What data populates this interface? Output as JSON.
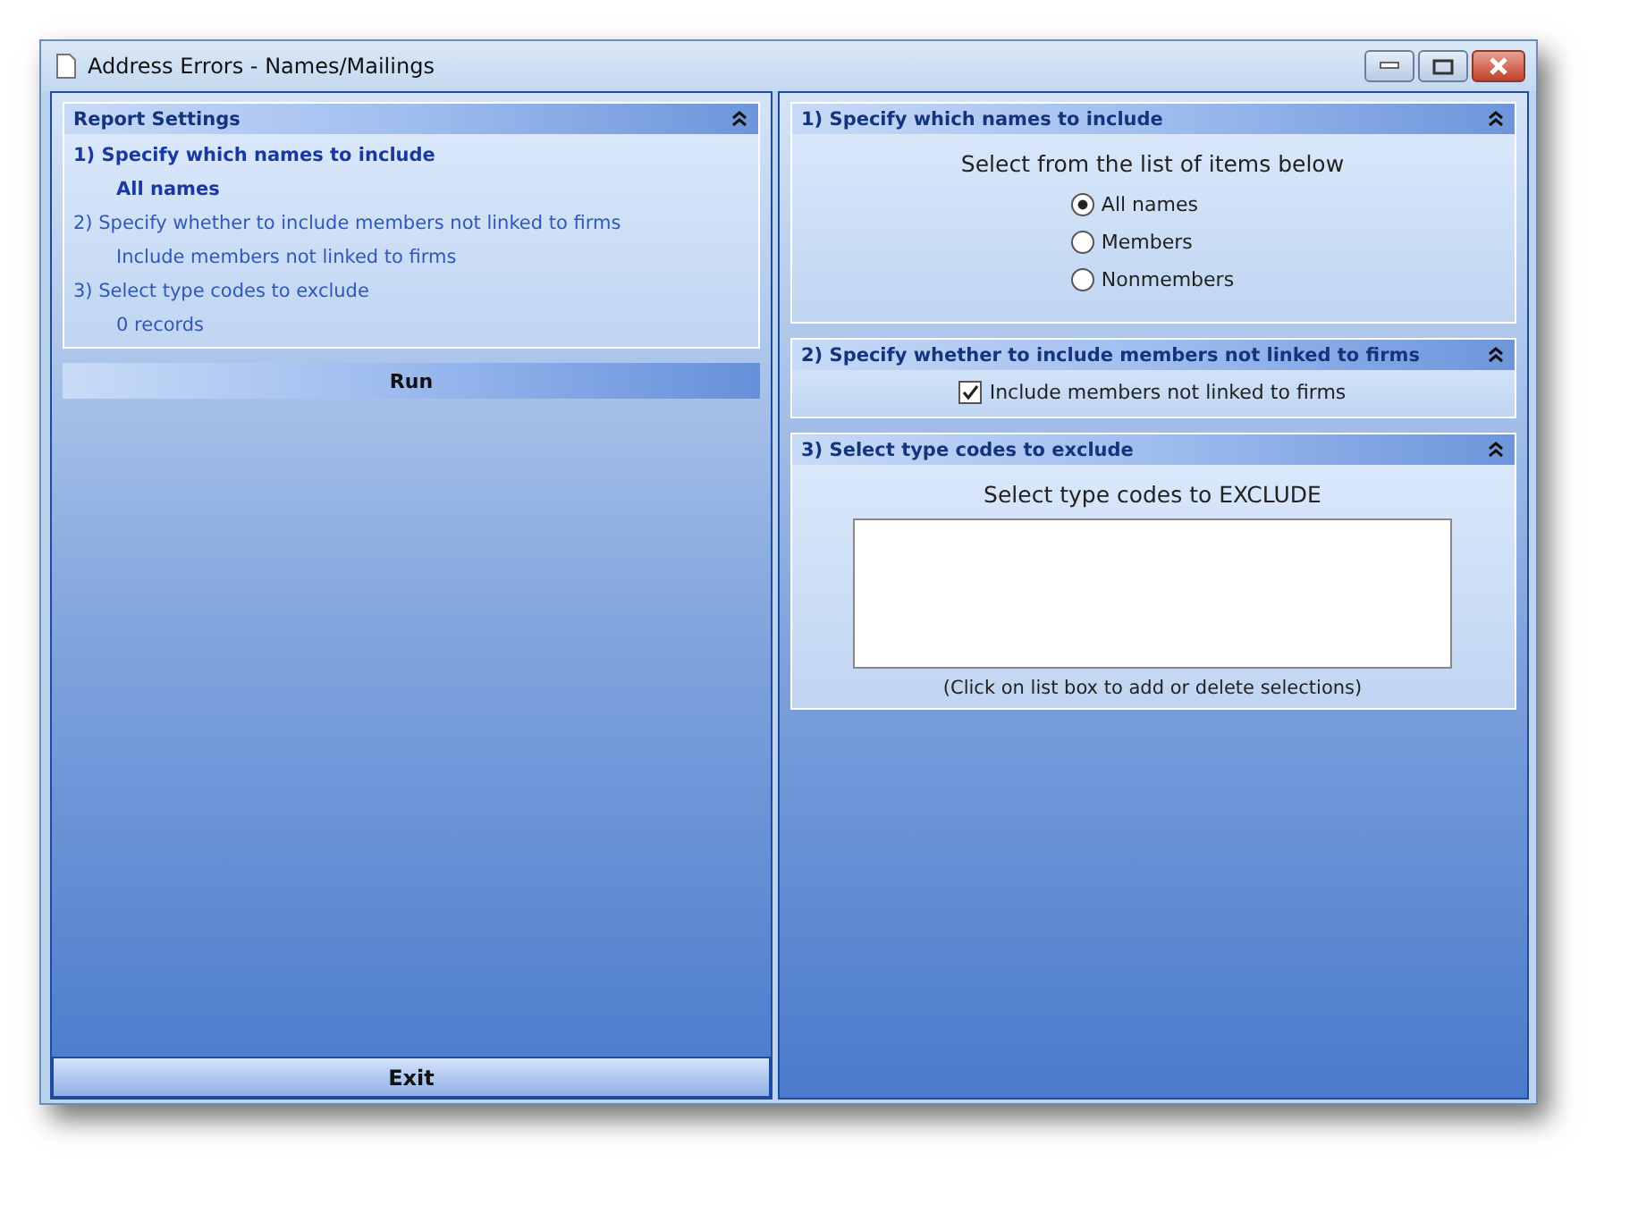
{
  "window": {
    "title": "Address Errors - Names/Mailings"
  },
  "report_settings": {
    "title": "Report Settings",
    "steps": [
      {
        "label": "1)  Specify which names to include",
        "value": "All names",
        "active": true
      },
      {
        "label": "2)  Specify whether to include members not linked to firms",
        "value": "Include members not linked to firms",
        "active": false
      },
      {
        "label": "3)  Select type codes to exclude",
        "value": "0 records",
        "active": false
      }
    ]
  },
  "run_button": "Run",
  "exit_button": "Exit",
  "sections": [
    {
      "kind": "radio",
      "title": "1)  Specify which names to include",
      "prompt": "Select from the list of items below",
      "options": [
        {
          "label": "All names",
          "selected": true
        },
        {
          "label": "Members",
          "selected": false
        },
        {
          "label": "Nonmembers",
          "selected": false
        }
      ]
    },
    {
      "kind": "checkbox",
      "title": "2)  Specify whether to include members not linked to firms",
      "options": [
        {
          "label": "Include members not linked to firms",
          "checked": true
        }
      ]
    },
    {
      "kind": "listbox",
      "title": "3)  Select type codes to exclude",
      "prompt": "Select type codes to EXCLUDE",
      "hint": "(Click on list box to add or delete selections)"
    }
  ]
}
